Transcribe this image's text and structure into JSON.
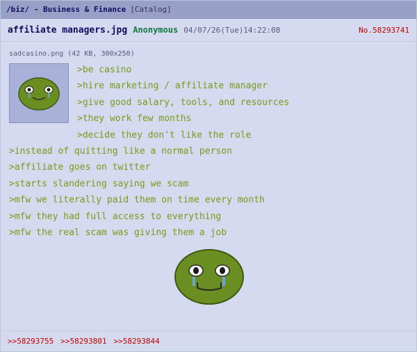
{
  "header": {
    "board": "/biz/ - Business & Finance",
    "catalog_link": "[Catalog]"
  },
  "post": {
    "subject": "affiliate managers.jpg",
    "name": "Anonymous",
    "datetime": "04/07/26(Tue)14:22:08",
    "post_number": "No.58293741",
    "file_info": "sadcasino.png (42 KB, 300x250)",
    "lines": [
      ">be casino",
      ">hire marketing / affiliate manager",
      ">give good salary, tools, and resources",
      ">they work few months",
      ">decide they don't like the role",
      ">instead of quitting like a normal person",
      ">affiliate goes on twitter",
      ">starts slandering saying we scam",
      ">mfw we literally paid them on time every month",
      ">mfw they had full access to everything",
      ">mfw the real scam was giving them a job"
    ]
  },
  "backlinks": [
    ">>58293755",
    ">>58293801",
    ">>58293844"
  ],
  "icons": {
    "thumbnail": "crying-frog-face-icon",
    "inline_image": "crying-frog-face-icon"
  },
  "colors": {
    "background": "#d6daf0",
    "topbar": "#98a0c8",
    "greentext": "#789922",
    "name": "#117743",
    "subject": "#0f0c5d",
    "post_number": "#c00000"
  }
}
